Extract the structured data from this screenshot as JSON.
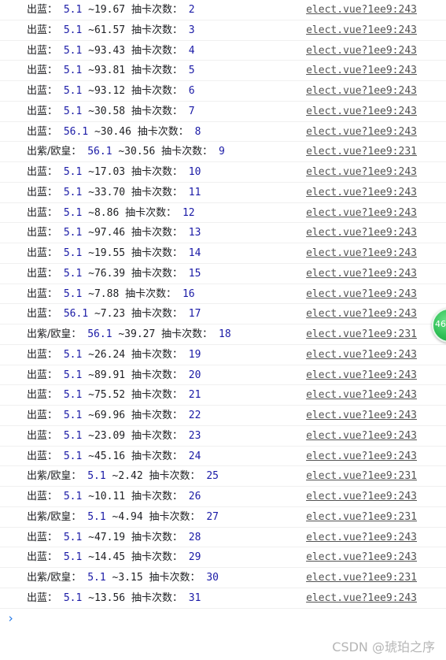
{
  "console": {
    "rows": [
      {
        "label": "出蓝：",
        "value": "5.1",
        "range": "~19.67",
        "count_label": "抽卡次数：",
        "count": "2",
        "source": "elect.vue?1ee9:243"
      },
      {
        "label": "出蓝：",
        "value": "5.1",
        "range": "~61.57",
        "count_label": "抽卡次数：",
        "count": "3",
        "source": "elect.vue?1ee9:243"
      },
      {
        "label": "出蓝：",
        "value": "5.1",
        "range": "~93.43",
        "count_label": "抽卡次数：",
        "count": "4",
        "source": "elect.vue?1ee9:243"
      },
      {
        "label": "出蓝：",
        "value": "5.1",
        "range": "~93.81",
        "count_label": "抽卡次数：",
        "count": "5",
        "source": "elect.vue?1ee9:243"
      },
      {
        "label": "出蓝：",
        "value": "5.1",
        "range": "~93.12",
        "count_label": "抽卡次数：",
        "count": "6",
        "source": "elect.vue?1ee9:243"
      },
      {
        "label": "出蓝：",
        "value": "5.1",
        "range": "~30.58",
        "count_label": "抽卡次数：",
        "count": "7",
        "source": "elect.vue?1ee9:243"
      },
      {
        "label": "出蓝：",
        "value": "56.1",
        "range": "~30.46",
        "count_label": "抽卡次数：",
        "count": "8",
        "source": "elect.vue?1ee9:243"
      },
      {
        "label": "出紫/欧皇：",
        "value": "56.1",
        "range": "~30.56",
        "count_label": "抽卡次数：",
        "count": "9",
        "source": "elect.vue?1ee9:231"
      },
      {
        "label": "出蓝：",
        "value": "5.1",
        "range": "~17.03",
        "count_label": "抽卡次数：",
        "count": "10",
        "source": "elect.vue?1ee9:243"
      },
      {
        "label": "出蓝：",
        "value": "5.1",
        "range": "~33.70",
        "count_label": "抽卡次数：",
        "count": "11",
        "source": "elect.vue?1ee9:243"
      },
      {
        "label": "出蓝：",
        "value": "5.1",
        "range": "~8.86",
        "count_label": "抽卡次数：",
        "count": "12",
        "source": "elect.vue?1ee9:243"
      },
      {
        "label": "出蓝：",
        "value": "5.1",
        "range": "~97.46",
        "count_label": "抽卡次数：",
        "count": "13",
        "source": "elect.vue?1ee9:243"
      },
      {
        "label": "出蓝：",
        "value": "5.1",
        "range": "~19.55",
        "count_label": "抽卡次数：",
        "count": "14",
        "source": "elect.vue?1ee9:243"
      },
      {
        "label": "出蓝：",
        "value": "5.1",
        "range": "~76.39",
        "count_label": "抽卡次数：",
        "count": "15",
        "source": "elect.vue?1ee9:243"
      },
      {
        "label": "出蓝：",
        "value": "5.1",
        "range": "~7.88",
        "count_label": "抽卡次数：",
        "count": "16",
        "source": "elect.vue?1ee9:243"
      },
      {
        "label": "出蓝：",
        "value": "56.1",
        "range": "~7.23",
        "count_label": "抽卡次数：",
        "count": "17",
        "source": "elect.vue?1ee9:243"
      },
      {
        "label": "出紫/欧皇：",
        "value": "56.1",
        "range": "~39.27",
        "count_label": "抽卡次数：",
        "count": "18",
        "source": "elect.vue?1ee9:231"
      },
      {
        "label": "出蓝：",
        "value": "5.1",
        "range": "~26.24",
        "count_label": "抽卡次数：",
        "count": "19",
        "source": "elect.vue?1ee9:243"
      },
      {
        "label": "出蓝：",
        "value": "5.1",
        "range": "~89.91",
        "count_label": "抽卡次数：",
        "count": "20",
        "source": "elect.vue?1ee9:243"
      },
      {
        "label": "出蓝：",
        "value": "5.1",
        "range": "~75.52",
        "count_label": "抽卡次数：",
        "count": "21",
        "source": "elect.vue?1ee9:243"
      },
      {
        "label": "出蓝：",
        "value": "5.1",
        "range": "~69.96",
        "count_label": "抽卡次数：",
        "count": "22",
        "source": "elect.vue?1ee9:243"
      },
      {
        "label": "出蓝：",
        "value": "5.1",
        "range": "~23.09",
        "count_label": "抽卡次数：",
        "count": "23",
        "source": "elect.vue?1ee9:243"
      },
      {
        "label": "出蓝：",
        "value": "5.1",
        "range": "~45.16",
        "count_label": "抽卡次数：",
        "count": "24",
        "source": "elect.vue?1ee9:243"
      },
      {
        "label": "出紫/欧皇：",
        "value": "5.1",
        "range": "~2.42",
        "count_label": "抽卡次数：",
        "count": "25",
        "source": "elect.vue?1ee9:231"
      },
      {
        "label": "出蓝：",
        "value": "5.1",
        "range": "~10.11",
        "count_label": "抽卡次数：",
        "count": "26",
        "source": "elect.vue?1ee9:243"
      },
      {
        "label": "出紫/欧皇：",
        "value": "5.1",
        "range": "~4.94",
        "count_label": "抽卡次数：",
        "count": "27",
        "source": "elect.vue?1ee9:231"
      },
      {
        "label": "出蓝：",
        "value": "5.1",
        "range": "~47.19",
        "count_label": "抽卡次数：",
        "count": "28",
        "source": "elect.vue?1ee9:243"
      },
      {
        "label": "出蓝：",
        "value": "5.1",
        "range": "~14.45",
        "count_label": "抽卡次数：",
        "count": "29",
        "source": "elect.vue?1ee9:243"
      },
      {
        "label": "出紫/欧皇：",
        "value": "5.1",
        "range": "~3.15",
        "count_label": "抽卡次数：",
        "count": "30",
        "source": "elect.vue?1ee9:231"
      },
      {
        "label": "出蓝：",
        "value": "5.1",
        "range": "~13.56",
        "count_label": "抽卡次数：",
        "count": "31",
        "source": "elect.vue?1ee9:243"
      }
    ],
    "prompt_icon": "chevron-right-icon",
    "prompt_glyph": "›"
  },
  "badge": {
    "text": "46",
    "color": "#2fbf55"
  },
  "watermark": {
    "text": "CSDN @琥珀之序"
  },
  "colors": {
    "number": "#1a1aa6",
    "source_link": "#545454",
    "prompt": "#1a73e8"
  }
}
